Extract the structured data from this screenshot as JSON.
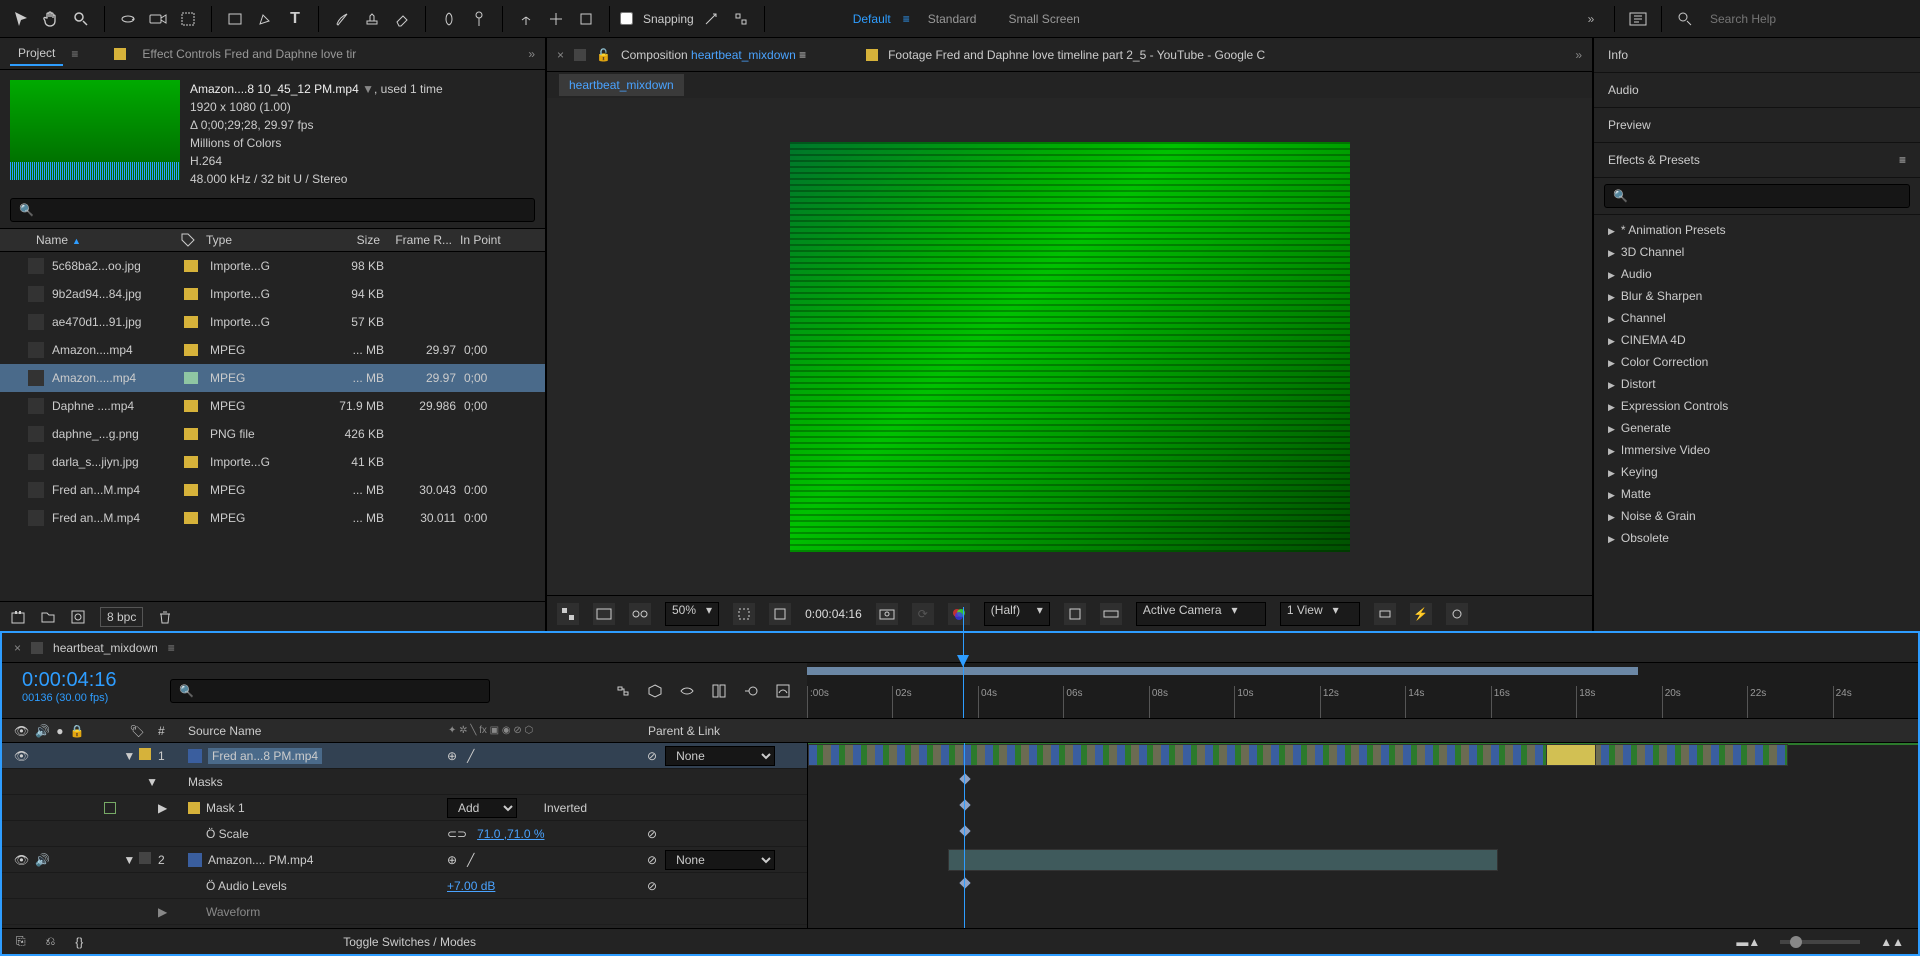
{
  "toolbar": {
    "snapping": "Snapping",
    "workspaces": [
      "Default",
      "Standard",
      "Small Screen"
    ],
    "active_workspace": 0,
    "search_placeholder": "Search Help"
  },
  "projectPanel": {
    "tab": "Project",
    "otherTab": "Effect Controls Fred and Daphne love tir",
    "selected": {
      "name": "Amazon....8 10_45_12 PM.mp4",
      "used": ", used 1 time",
      "res": "1920 x 1080 (1.00)",
      "dur": "Δ 0;00;29;28, 29.97 fps",
      "colors": "Millions of Colors",
      "codec": "H.264",
      "audio": "48.000 kHz / 32 bit U / Stereo"
    },
    "columns": {
      "name": "Name",
      "type": "Type",
      "size": "Size",
      "frame": "Frame R...",
      "inpoint": "In Point"
    },
    "rows": [
      {
        "name": "5c68ba2...oo.jpg",
        "type": "Importe...G",
        "size": "98 KB",
        "fr": "",
        "ip": ""
      },
      {
        "name": "9b2ad94...84.jpg",
        "type": "Importe...G",
        "size": "94 KB",
        "fr": "",
        "ip": ""
      },
      {
        "name": "ae470d1...91.jpg",
        "type": "Importe...G",
        "size": "57 KB",
        "fr": "",
        "ip": ""
      },
      {
        "name": "Amazon....mp4",
        "type": "MPEG",
        "size": "... MB",
        "fr": "29.97",
        "ip": "0;00"
      },
      {
        "name": "Amazon.....mp4",
        "type": "MPEG",
        "size": "... MB",
        "fr": "29.97",
        "ip": "0;00"
      },
      {
        "name": "Daphne ....mp4",
        "type": "MPEG",
        "size": "71.9 MB",
        "fr": "29.986",
        "ip": "0;00"
      },
      {
        "name": "daphne_...g.png",
        "type": "PNG file",
        "size": "426 KB",
        "fr": "",
        "ip": ""
      },
      {
        "name": "darla_s...jiyn.jpg",
        "type": "Importe...G",
        "size": "41 KB",
        "fr": "",
        "ip": ""
      },
      {
        "name": "Fred an...M.mp4",
        "type": "MPEG",
        "size": "... MB",
        "fr": "30.043",
        "ip": "0:00"
      },
      {
        "name": "Fred an...M.mp4",
        "type": "MPEG",
        "size": "... MB",
        "fr": "30.011",
        "ip": "0:00"
      }
    ],
    "selectedRow": 4,
    "bpc": "8 bpc"
  },
  "composition": {
    "labelPrefix": "Composition",
    "name": "heartbeat_mixdown",
    "otherTab": "Footage Fred and Daphne love timeline part 2_5 - YouTube - Google C",
    "subTab": "heartbeat_mixdown",
    "footer": {
      "zoom": "50%",
      "time": "0:00:04:16",
      "res": "(Half)",
      "camera": "Active Camera",
      "views": "1 View"
    }
  },
  "rightPanels": {
    "sections": [
      "Info",
      "Audio",
      "Preview"
    ],
    "effects_title": "Effects & Presets",
    "effects": [
      "* Animation Presets",
      "3D Channel",
      "Audio",
      "Blur & Sharpen",
      "Channel",
      "CINEMA 4D",
      "Color Correction",
      "Distort",
      "Expression Controls",
      "Generate",
      "Immersive Video",
      "Keying",
      "Matte",
      "Noise & Grain",
      "Obsolete"
    ]
  },
  "timeline": {
    "comp": "heartbeat_mixdown",
    "time": "0:00:04:16",
    "frames": "00136 (30.00 fps)",
    "ticks": [
      ":00s",
      "02s",
      "04s",
      "06s",
      "08s",
      "10s",
      "12s",
      "14s",
      "16s",
      "18s",
      "20s",
      "22s",
      "24s"
    ],
    "cols": {
      "num": "#",
      "src": "Source Name",
      "parent": "Parent & Link"
    },
    "layers": [
      {
        "num": "1",
        "name": "Fred an...8 PM.mp4",
        "parent": "None",
        "selected": true
      },
      {
        "masksLabel": "Masks"
      },
      {
        "maskName": "Mask 1",
        "maskMode": "Add",
        "inverted": "Inverted"
      },
      {
        "prop": "Scale",
        "val": "71.0 ,71.0 %"
      },
      {
        "num": "2",
        "name": "Amazon.... PM.mp4",
        "parent": "None"
      },
      {
        "prop": "Audio Levels",
        "val": "+7.00 dB"
      },
      {
        "prop": "Waveform"
      }
    ],
    "toggle": "Toggle Switches / Modes"
  }
}
